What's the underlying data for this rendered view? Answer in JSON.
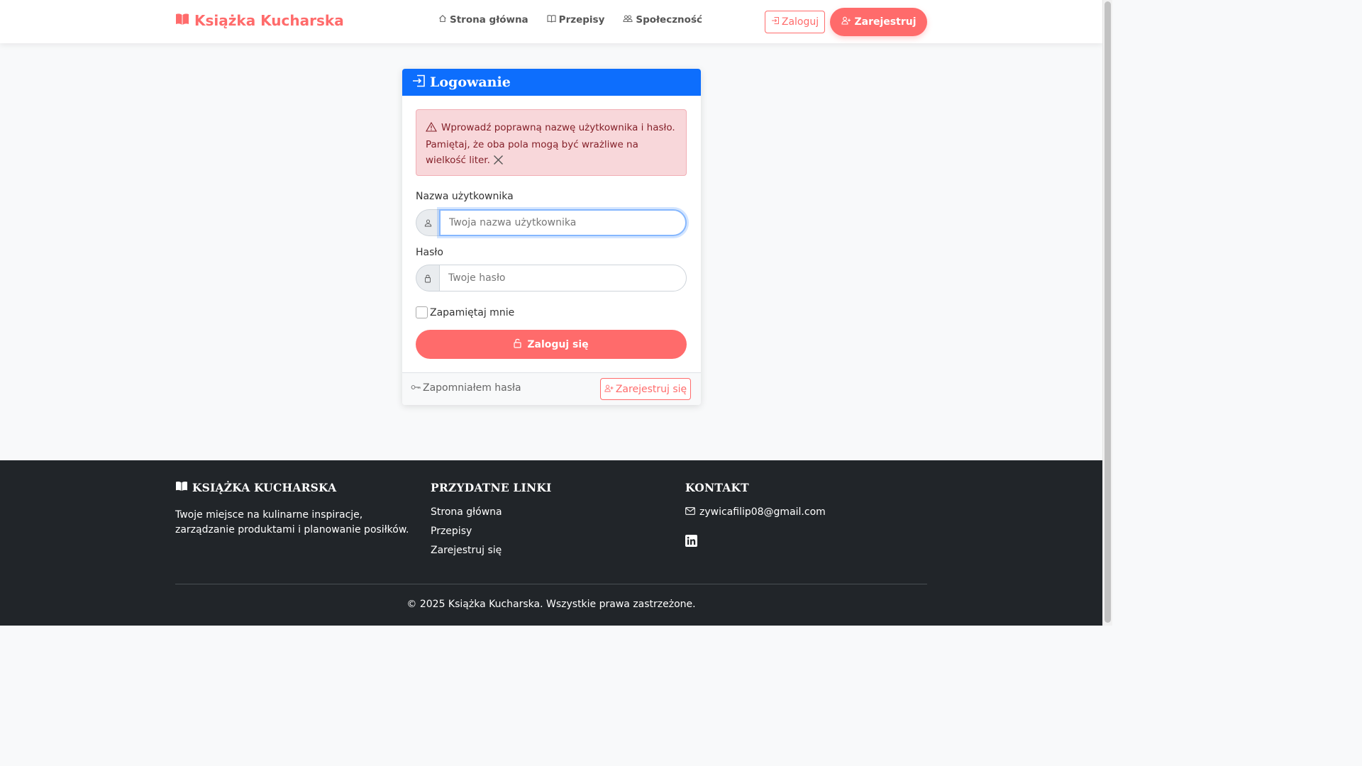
{
  "navbar": {
    "brand": "Książka Kucharska",
    "links": [
      {
        "label": "Strona główna",
        "icon": "house-icon"
      },
      {
        "label": "Przepisy",
        "icon": "book-icon"
      },
      {
        "label": "Społeczność",
        "icon": "people-icon"
      }
    ],
    "login_label": "Zaloguj",
    "register_label": "Zarejestruj"
  },
  "login_card": {
    "title": "Logowanie",
    "alert_text": "Wprowadź poprawną nazwę użytkownika i hasło. Pamiętaj, że oba pola mogą być wrażliwe na wielkość liter.",
    "username_label": "Nazwa użytkownika",
    "username_placeholder": "Twoja nazwa użytkownika",
    "username_value": "",
    "password_label": "Hasło",
    "password_placeholder": "Twoje hasło",
    "password_value": "",
    "remember_label": "Zapamiętaj mnie",
    "remember_checked": false,
    "submit_label": "Zaloguj się",
    "forgot_label": "Zapomniałem hasła",
    "register_label": "Zarejestruj się"
  },
  "footer": {
    "brand_title": "KSIĄŻKA KUCHARSKA",
    "description": "Twoje miejsce na kulinarne inspiracje, zarządzanie produktami i planowanie posiłków.",
    "links_title": "PRZYDATNE LINKI",
    "links": [
      "Strona główna",
      "Przepisy",
      "Zarejestruj się"
    ],
    "contact_title": "KONTAKT",
    "email": "zywicafilip08@gmail.com",
    "social_icon": "linkedin-icon",
    "copyright": "© 2025 Książka Kucharska. Wszystkie prawa zastrzeżone."
  },
  "colors": {
    "accent": "#ff6b6b",
    "primary": "#0d6efd",
    "alert_bg": "#f8d7da",
    "alert_text": "#842029",
    "footer_bg": "#212529"
  }
}
